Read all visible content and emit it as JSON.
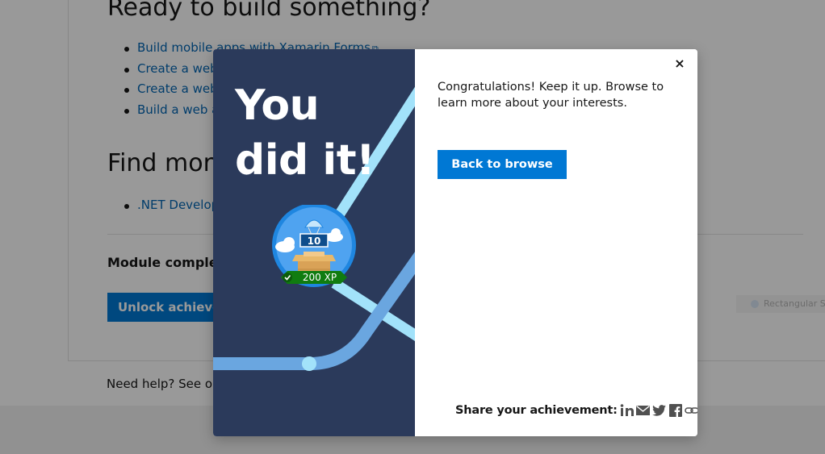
{
  "background": {
    "heading_ready": "Ready to build something?",
    "ready_links": [
      "Build mobile apps with Xamarin.Forms",
      "Create a web",
      "Create a web",
      "Build a web a"
    ],
    "heading_find": "Find mor",
    "find_links": [
      ".NET Develop"
    ],
    "module_complete": "Module complet",
    "unlock_button": "Unlock achievem",
    "need_help": "Need help? See ou",
    "chip_label": "Rectangular Sn"
  },
  "modal": {
    "headline_line1": "You",
    "headline_line2": "did it!",
    "badge": {
      "number": "10",
      "xp_label": "200 XP",
      "icon": "parachute-box-icon"
    },
    "close_label": "×",
    "congrats_text": "Congratulations! Keep it up. Browse to learn more about your interests.",
    "back_button": "Back to browse",
    "share_label": "Share your achievement:",
    "share_icons": [
      "linkedin-icon",
      "email-icon",
      "twitter-icon",
      "facebook-icon",
      "link-icon"
    ]
  },
  "colors": {
    "modal_left_bg": "#2b3a5b",
    "accent_blue": "#0078d4",
    "link_blue": "#0065b3",
    "xp_ribbon": "#107c10",
    "path_light": "#a2e2fa",
    "path_mid": "#6aa6e0"
  }
}
